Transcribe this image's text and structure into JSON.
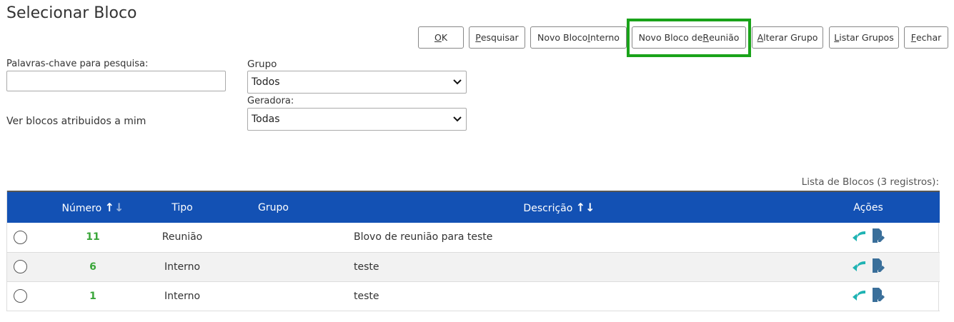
{
  "page": {
    "title": "Selecionar Bloco"
  },
  "toolbar": {
    "ok": {
      "prefix": "",
      "key": "O",
      "rest": "K"
    },
    "pesquisar": {
      "prefix": "",
      "key": "P",
      "rest": "esquisar"
    },
    "novo_interno": {
      "prefix": "Novo Bloco ",
      "key": "I",
      "rest": "nterno"
    },
    "novo_reuniao": {
      "prefix": "Novo Bloco de ",
      "key": "R",
      "rest": "eunião"
    },
    "alterar_grupo": {
      "prefix": "",
      "key": "A",
      "rest": "lterar Grupo"
    },
    "listar_grupos": {
      "prefix": "",
      "key": "L",
      "rest": "istar Grupos"
    },
    "fechar": {
      "prefix": "",
      "key": "F",
      "rest": "echar"
    }
  },
  "filters": {
    "keywords_label": "Palavras-chave para pesquisa:",
    "keywords_value": "",
    "grupo_label": "Grupo",
    "grupo_value": "Todos",
    "geradora_label": "Geradora:",
    "geradora_value": "Todas",
    "atribuidos_label": "Ver blocos atribuidos a mim"
  },
  "table": {
    "caption": "Lista de Blocos (3 registros):",
    "headers": {
      "numero": "Número",
      "tipo": "Tipo",
      "grupo": "Grupo",
      "descricao": "Descrição",
      "acoes": "Ações"
    },
    "rows": [
      {
        "numero": "11",
        "tipo": "Reunião",
        "grupo": "",
        "descricao": "Blovo de reunião para teste"
      },
      {
        "numero": "6",
        "tipo": "Interno",
        "grupo": "",
        "descricao": "teste"
      },
      {
        "numero": "1",
        "tipo": "Interno",
        "grupo": "",
        "descricao": "teste"
      }
    ]
  },
  "colors": {
    "header_bg": "#1351b4",
    "highlight": "#1aa31a",
    "number": "#3aa63a",
    "action_arrow": "#1fb3b3",
    "action_edit": "#3a6f9a"
  }
}
